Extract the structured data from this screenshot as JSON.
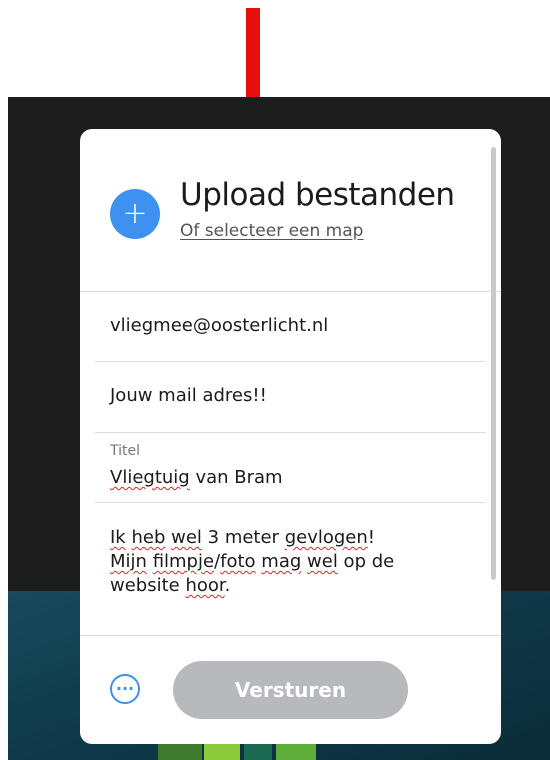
{
  "annotation": {
    "color": "#e8100c"
  },
  "card": {
    "title": "Upload bestanden",
    "folder_link": "Of selecteer een map",
    "plus_icon": "plus-icon",
    "accent_color": "#3d91f0"
  },
  "form": {
    "recipient": "vliegmee@oosterlicht.nl",
    "sender_email": "Jouw mail adres!!",
    "title_label": "Titel",
    "title_value_word1": "Vliegtuig",
    "title_value_rest": " van Bram",
    "message": {
      "l1_a": "Ik",
      "l1_b": " ",
      "l1_c": "heb",
      "l1_d": " ",
      "l1_e": "wel",
      "l1_f": " 3 meter ",
      "l1_g": "gevlogen",
      "l1_h": "!",
      "l2_a": "Mijn",
      "l2_b": " ",
      "l2_c": "filmpje",
      "l2_d": "/",
      "l2_e": "foto",
      "l2_f": " ",
      "l2_g": "mag",
      "l2_h": " ",
      "l2_i": "wel",
      "l2_j": " op de",
      "l3_a": "website ",
      "l3_b": "hoor",
      "l3_c": "."
    }
  },
  "footer": {
    "more_icon": "ellipsis-icon",
    "more_glyph": "···",
    "send_label": "Versturen",
    "send_color": "#b8b9bd"
  }
}
